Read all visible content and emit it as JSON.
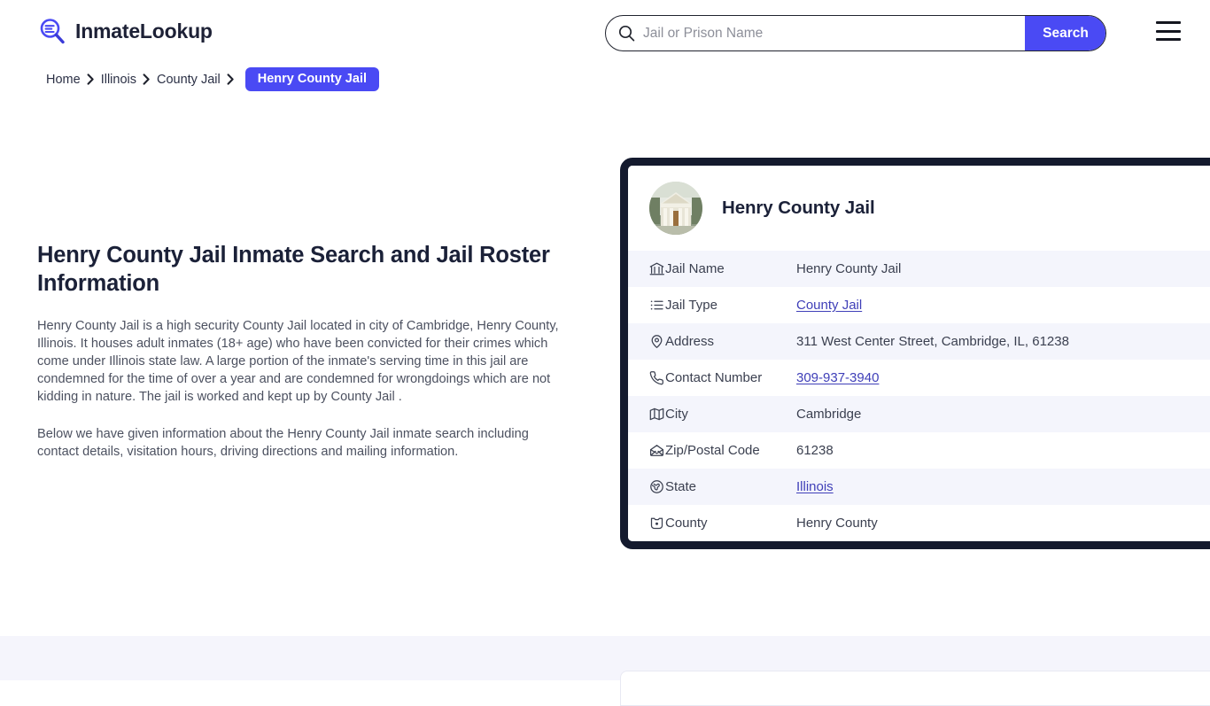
{
  "header": {
    "logo": {
      "icon": "magnifier-list-icon",
      "text": "InmateLookup"
    },
    "search": {
      "icon": "search-icon",
      "placeholder": "Jail or Prison Name",
      "value": "",
      "button_label": "Search"
    },
    "menu": {
      "icon": "hamburger-menu-icon",
      "label": "Menu"
    },
    "accent_color": "#4a4af4"
  },
  "breadcrumb": {
    "items": [
      {
        "label": "Home",
        "current": false
      },
      {
        "label": "Illinois",
        "current": false
      },
      {
        "label": "County Jail",
        "current": false
      },
      {
        "label": "Henry County Jail",
        "current": true
      }
    ],
    "separator_icon": "chevron-right-icon"
  },
  "main": {
    "title": "Henry County Jail Inmate Search and Jail Roster Information",
    "paragraphs": [
      "Henry County Jail is a high security County Jail located in city of Cambridge, Henry County, Illinois. It houses adult inmates (18+ age) who have been convicted for their crimes which come under Illinois state law. A large portion of the inmate's serving time in this jail are condemned for the time of over a year and are condemned for wrongdoings which are not kidding in nature. The jail is worked and kept up by County Jail .",
      "Below we have given information about the Henry County Jail inmate search including contact details, visitation hours, driving directions and mailing information."
    ]
  },
  "info_card": {
    "thumbnail_icon": "courthouse-photo",
    "title": "Henry County Jail",
    "border_color": "#141a2e",
    "rows": [
      {
        "icon": "bank-icon",
        "label": "Jail Name",
        "value": "Henry County Jail",
        "is_link": false
      },
      {
        "icon": "list-icon",
        "label": "Jail Type",
        "value": "County Jail",
        "is_link": true
      },
      {
        "icon": "map-pin-icon",
        "label": "Address",
        "value": "311 West Center Street, Cambridge, IL, 61238",
        "is_link": false
      },
      {
        "icon": "phone-icon",
        "label": "Contact Number",
        "value": "309-937-3940",
        "is_link": true
      },
      {
        "icon": "map-icon",
        "label": "City",
        "value": "Cambridge",
        "is_link": false
      },
      {
        "icon": "envelope-icon",
        "label": "Zip/Postal Code",
        "value": "61238",
        "is_link": false
      },
      {
        "icon": "globe-icon",
        "label": "State",
        "value": "Illinois",
        "is_link": true
      },
      {
        "icon": "shield-icon",
        "label": "County",
        "value": "Henry County",
        "is_link": false
      }
    ]
  }
}
